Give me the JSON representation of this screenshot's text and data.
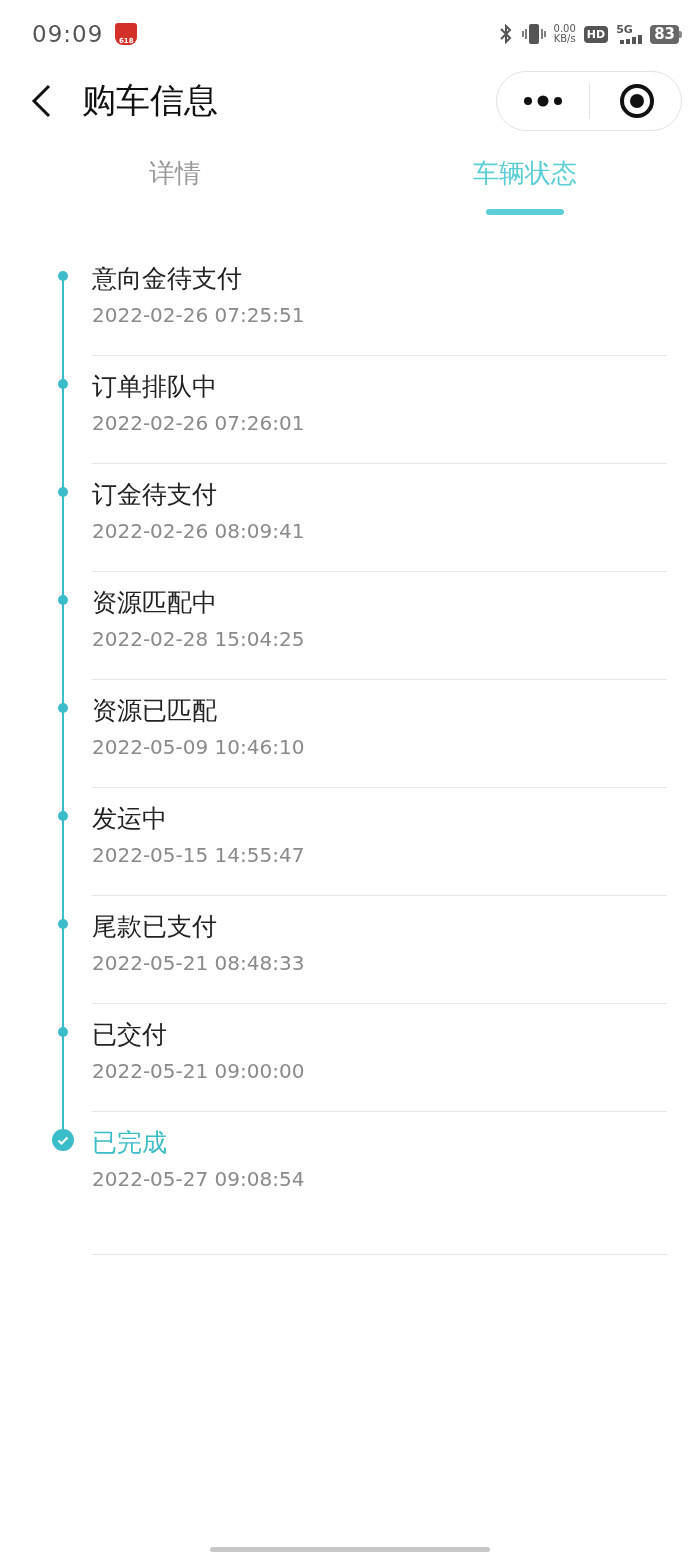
{
  "status_bar": {
    "time": "09:09",
    "logo_text": "618",
    "speed_value": "0.00",
    "speed_unit": "KB/s",
    "hd": "HD",
    "network": "5G",
    "battery": "83"
  },
  "nav": {
    "title": "购车信息"
  },
  "tabs": [
    {
      "label": "详情",
      "selected": false
    },
    {
      "label": "车辆状态",
      "selected": true
    }
  ],
  "timeline": [
    {
      "title": "意向金待支付",
      "time": "2022-02-26 07:25:51",
      "current": false
    },
    {
      "title": "订单排队中",
      "time": "2022-02-26 07:26:01",
      "current": false
    },
    {
      "title": "订金待支付",
      "time": "2022-02-26 08:09:41",
      "current": false
    },
    {
      "title": "资源匹配中",
      "time": "2022-02-28 15:04:25",
      "current": false
    },
    {
      "title": "资源已匹配",
      "time": "2022-05-09 10:46:10",
      "current": false
    },
    {
      "title": "发运中",
      "time": "2022-05-15 14:55:47",
      "current": false
    },
    {
      "title": "尾款已支付",
      "time": "2022-05-21 08:48:33",
      "current": false
    },
    {
      "title": "已交付",
      "time": "2022-05-21 09:00:00",
      "current": false
    },
    {
      "title": "已完成",
      "time": "2022-05-27 09:08:54",
      "current": true
    }
  ]
}
